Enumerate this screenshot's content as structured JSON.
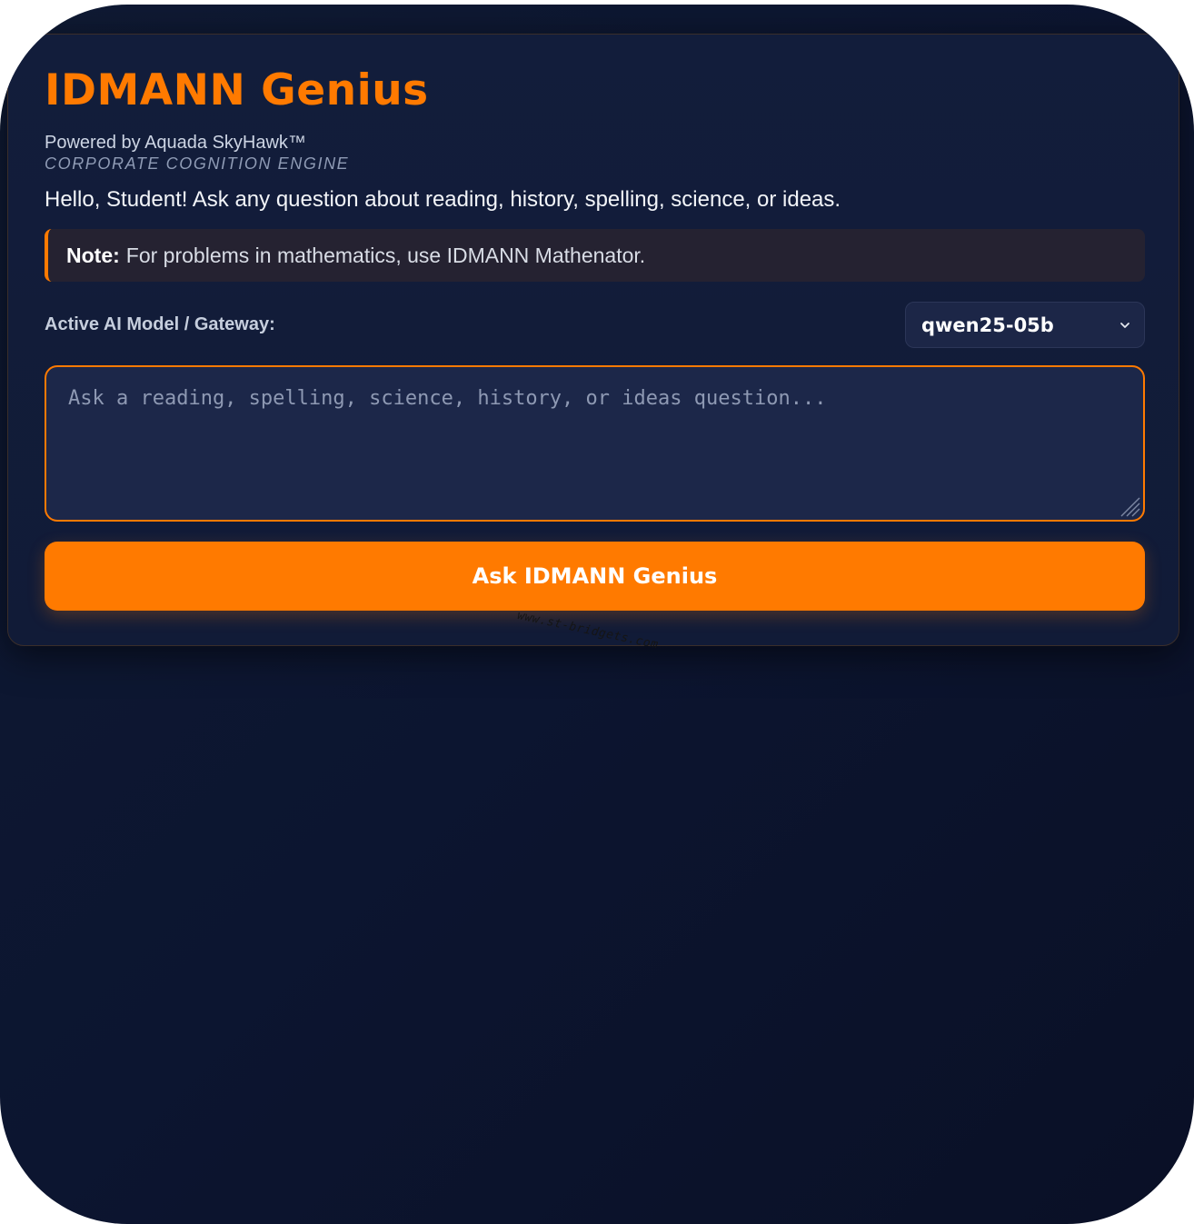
{
  "app": {
    "title": "IDMANN Genius",
    "powered_by": "Powered by Aquada SkyHawk™",
    "engine_tagline": "CORPORATE COGNITION ENGINE",
    "greeting": "Hello, Student! Ask any question about reading, history, spelling, science, or ideas."
  },
  "note": {
    "label": "Note:",
    "text": "For problems in mathematics, use IDMANN Mathenator."
  },
  "model": {
    "label": "Active AI Model / Gateway:",
    "selected": "qwen25-05b"
  },
  "question": {
    "value": "",
    "placeholder": "Ask a reading, spelling, science, history, or ideas question..."
  },
  "ask_button": {
    "label": "Ask IDMANN Genius"
  },
  "watermark": {
    "text": "www.st-bridgets.com"
  },
  "icons": {
    "select_arrow": "chevron-down-icon",
    "resize": "resize-grip-icon"
  },
  "colors": {
    "accent": "#ff7a00",
    "background": "#0c1530",
    "card": "#121d3b",
    "note_background": "#252231",
    "input_background": "#1c2749"
  }
}
